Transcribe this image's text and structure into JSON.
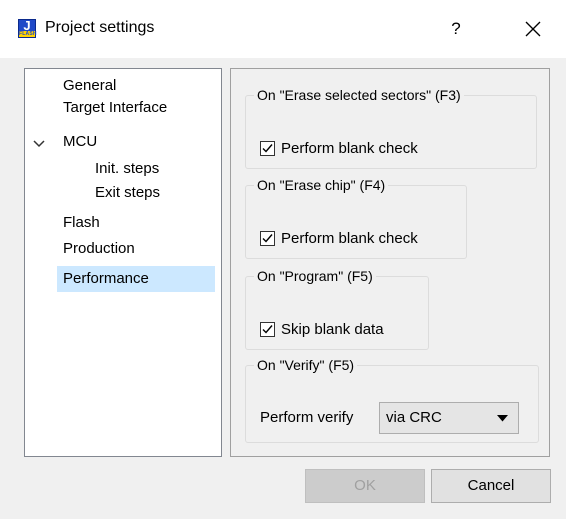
{
  "window": {
    "title": "Project settings",
    "help_label": "?",
    "close_icon": "close-icon",
    "app_icon": {
      "letter": "J",
      "badge": "FLASH"
    }
  },
  "tree": {
    "items": [
      {
        "label": "General"
      },
      {
        "label": "Target Interface"
      },
      {
        "label": "MCU",
        "expanded": true
      },
      {
        "label": "Init. steps"
      },
      {
        "label": "Exit steps"
      },
      {
        "label": "Flash"
      },
      {
        "label": "Production"
      },
      {
        "label": "Performance",
        "selected": true
      }
    ]
  },
  "groups": {
    "erase_selected": {
      "legend": "On \"Erase selected sectors\" (F3)",
      "checkbox_label": "Perform blank check",
      "checked": true
    },
    "erase_chip": {
      "legend": "On \"Erase chip\" (F4)",
      "checkbox_label": "Perform blank check",
      "checked": true
    },
    "program": {
      "legend": "On \"Program\" (F5)",
      "checkbox_label": "Skip blank data",
      "checked": true
    },
    "verify": {
      "legend": "On \"Verify\" (F5)",
      "label": "Perform verify",
      "selected_value": "via CRC"
    }
  },
  "buttons": {
    "ok": "OK",
    "cancel": "Cancel"
  },
  "colors": {
    "selection": "#cce8ff",
    "background": "#f0f0f0"
  }
}
